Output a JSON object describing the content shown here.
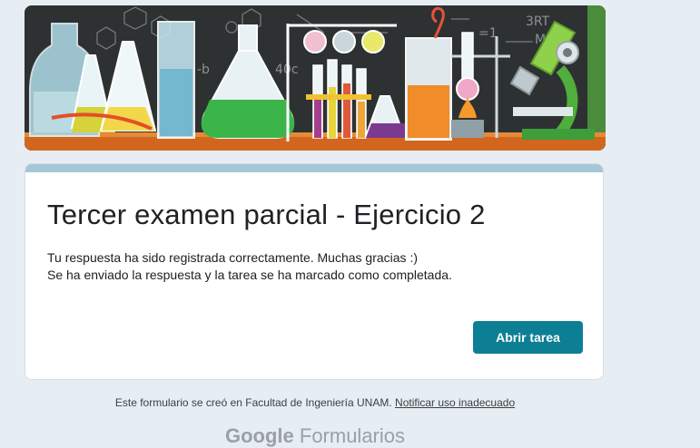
{
  "form": {
    "title": "Tercer examen parcial - Ejercicio 2",
    "message_line1": "Tu respuesta ha sido registrada correctamente. Muchas gracias :)",
    "message_line2": "Se ha enviado la respuesta y la tarea se ha marcado como completada.",
    "open_task_button": "Abrir tarea"
  },
  "banner": {
    "chalkboard_text": [
      "3RT",
      "M",
      "=1",
      "40c",
      "-b"
    ]
  },
  "footer": {
    "created_text": "Este formulario se creó en Facultad de Ingeniería UNAM.",
    "report_link": "Notificar uso inadecuado",
    "brand_google": "Google",
    "brand_product": "Formularios"
  },
  "colors": {
    "page_bg": "#e6eef4",
    "accent": "#a3c7d7",
    "button": "#0d7f95",
    "chalkboard": "#2e3132"
  }
}
